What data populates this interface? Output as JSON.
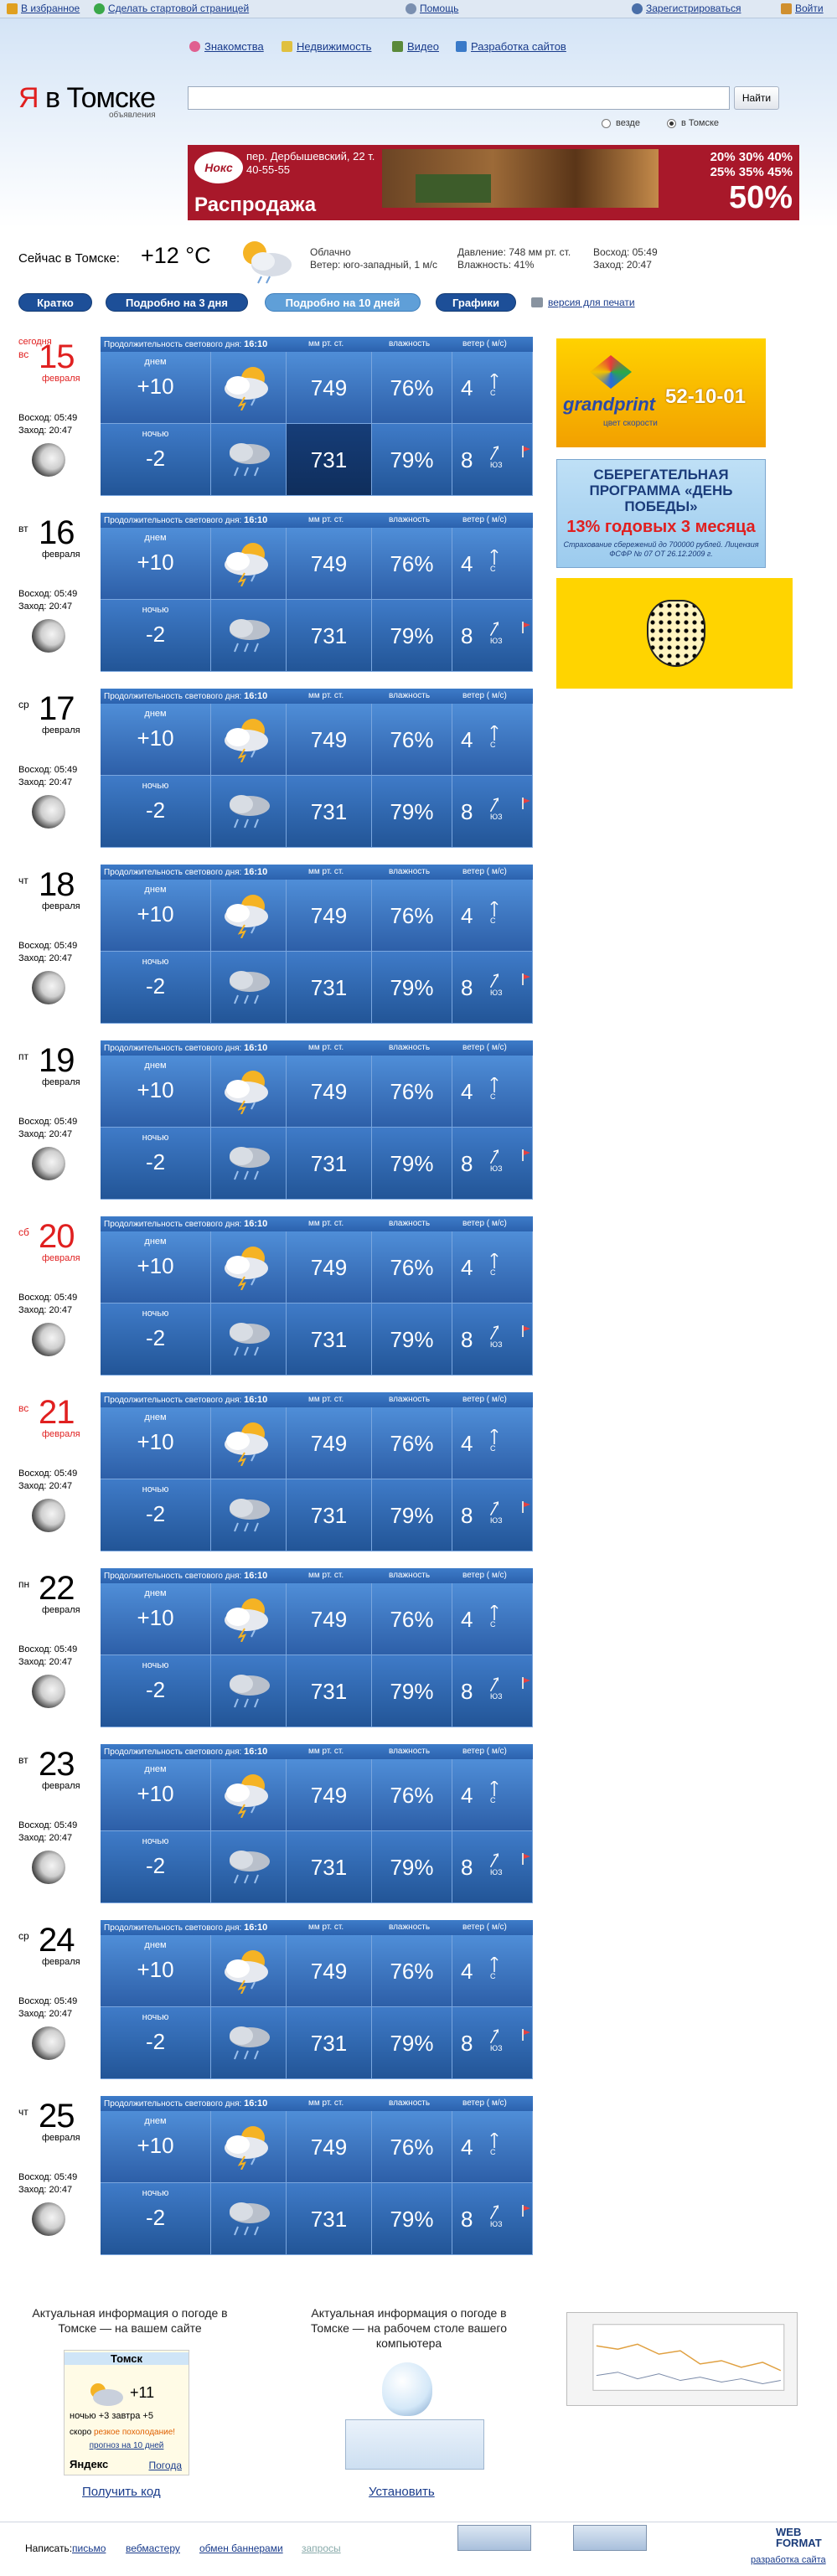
{
  "topbar": {
    "favorites": "В избранное",
    "make_start": "Сделать стартовой страницей",
    "help": "Помощь",
    "register": "Зарегистрироваться",
    "login": "Войти"
  },
  "services": [
    "Знакомства",
    "Недвижимость",
    "Видео",
    "Разработка сайтов"
  ],
  "logo": {
    "ya": "Я",
    "city": "в Томске",
    "sub": "объявления"
  },
  "search": {
    "button": "Найти",
    "radio_all": "везде",
    "radio_city": "в Томске"
  },
  "banner": {
    "logo": "Нокс",
    "address": "пер. Дербышевский, 22 т. 40-55-55",
    "sale": "Распродажа",
    "percents": "20% 30% 40% 25% 35% 45%",
    "big_pct": "50%"
  },
  "now": {
    "label": "Сейчас в Томске:",
    "temp": "+12 °C",
    "cond": "Облачно",
    "wind": "Ветер: юго-западный, 1 м/с",
    "pressure": "Давление: 748 мм рт. ст.",
    "humidity": "Влажность: 41%",
    "sunrise": "Восход: 05:49",
    "sunset": "Заход: 20:47"
  },
  "tabs": [
    "Кратко",
    "Подробно на 3 дня",
    "Подробно на 10 дней",
    "Графики"
  ],
  "print_link": "версия для печати",
  "table_header": {
    "daylength_label": "Продолжительность светового дня:",
    "daylength": "16:10",
    "pressure": "мм рт. ст.",
    "humidity": "влажность",
    "wind": "ветер ( м/с)"
  },
  "labels": {
    "day": "днем",
    "night": "ночью",
    "today": "сегодня",
    "sunrise": "Восход: 05:49",
    "sunset": "Заход: 20:47"
  },
  "days": [
    {
      "wd": "вс",
      "num": "15",
      "mon": "февраля",
      "red": true,
      "today": true
    },
    {
      "wd": "вт",
      "num": "16",
      "mon": "февраля",
      "red": false,
      "today": false
    },
    {
      "wd": "ср",
      "num": "17",
      "mon": "февраля",
      "red": false,
      "today": false
    },
    {
      "wd": "чт",
      "num": "18",
      "mon": "февраля",
      "red": false,
      "today": false
    },
    {
      "wd": "пт",
      "num": "19",
      "mon": "февраля",
      "red": false,
      "today": false
    },
    {
      "wd": "сб",
      "num": "20",
      "mon": "февраля",
      "red": true,
      "today": false
    },
    {
      "wd": "вс",
      "num": "21",
      "mon": "февраля",
      "red": true,
      "today": false
    },
    {
      "wd": "пн",
      "num": "22",
      "mon": "февраля",
      "red": false,
      "today": false
    },
    {
      "wd": "вт",
      "num": "23",
      "mon": "февраля",
      "red": false,
      "today": false
    },
    {
      "wd": "ср",
      "num": "24",
      "mon": "февраля",
      "red": false,
      "today": false
    },
    {
      "wd": "чт",
      "num": "25",
      "mon": "февраля",
      "red": false,
      "today": false
    }
  ],
  "forecast": {
    "day": {
      "temp": "+10",
      "pressure": "749",
      "humidity": "76%",
      "wind": "4",
      "dir": "С"
    },
    "night": {
      "temp": "-2",
      "pressure": "731",
      "humidity": "79%",
      "wind": "8",
      "dir": "ЮЗ"
    }
  },
  "ads": {
    "gp_name": "grandprint",
    "gp_phone": "52-10-01",
    "gp_slogan": "цвет скорости",
    "sb_title": "СБЕРЕГАТЕЛЬНАЯ ПРОГРАММА «ДЕНЬ ПОБЕДЫ»",
    "sb_rate": "13% годовых 3 месяца",
    "sb_note": "Страхование сбережений до 700000 рублей. Лицензия ФСФР № 07 ОТ 26.12.2009 г."
  },
  "bottom": {
    "w_text": "Актуальная информация о погоде в Томске — на вашем сайте",
    "w_city": "Томск",
    "w_temp": "+11",
    "w_nightday": "ночью +3   завтра +5",
    "w_soon": "скоро",
    "w_soon_red": "резкое похолодание!",
    "w_link": "прогноз на 10 дней",
    "w_ya": "Яндекс",
    "w_weather": "Погода",
    "g_text": "Актуальная информация о погоде в Томске — на рабочем столе вашего компьютера",
    "get_code": "Получить код",
    "install": "Установить"
  },
  "footer": {
    "write": "Написать:",
    "letter": "письмо",
    "webmaster": "вебмастеру",
    "banners": "обмен баннерами",
    "requests": "запросы",
    "razr": "разработка сайта",
    "webformat": "WEB FORMAT"
  }
}
